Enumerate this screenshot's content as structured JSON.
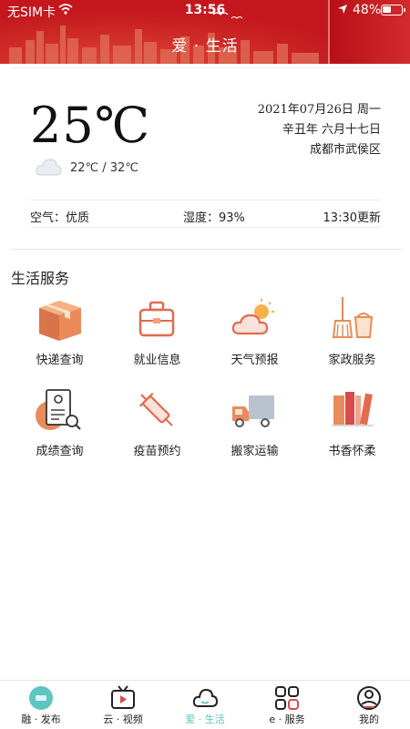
{
  "status_bar": {
    "carrier": "无SIM卡",
    "time": "13:56",
    "battery": "48%",
    "battery_level": 0.48
  },
  "header": {
    "title": "爱 · 生活"
  },
  "weather": {
    "temperature": "25℃",
    "range": "22℃ / 32℃",
    "date": "2021年07月26日 周一",
    "lunar": "辛丑年 六月十七日",
    "location": "成都市武侯区",
    "air_label": "空气：优质",
    "humidity_label": "湿度：93%",
    "update_label": "13:30更新"
  },
  "services": {
    "title": "生活服务",
    "items": [
      {
        "label": "快递查询",
        "icon": "package-icon"
      },
      {
        "label": "就业信息",
        "icon": "briefcase-icon"
      },
      {
        "label": "天气预报",
        "icon": "weather-icon"
      },
      {
        "label": "家政服务",
        "icon": "broom-icon"
      },
      {
        "label": "成绩查询",
        "icon": "scores-icon"
      },
      {
        "label": "疫苗预约",
        "icon": "syringe-icon"
      },
      {
        "label": "搬家运输",
        "icon": "truck-icon"
      },
      {
        "label": "书香怀柔",
        "icon": "books-icon"
      }
    ]
  },
  "tabbar": {
    "items": [
      {
        "label": "融 · 发布",
        "icon": "news-icon"
      },
      {
        "label": "云 · 视频",
        "icon": "tv-icon"
      },
      {
        "label": "爱 · 生活",
        "icon": "life-icon",
        "active": true
      },
      {
        "label": "e · 服务",
        "icon": "grid-icon"
      },
      {
        "label": "我的",
        "icon": "profile-icon"
      }
    ]
  },
  "colors": {
    "header_red": "#c3171d",
    "accent_teal": "#5dc6c0",
    "icon_orange": "#e98b5a",
    "icon_red": "#d94a4a"
  }
}
